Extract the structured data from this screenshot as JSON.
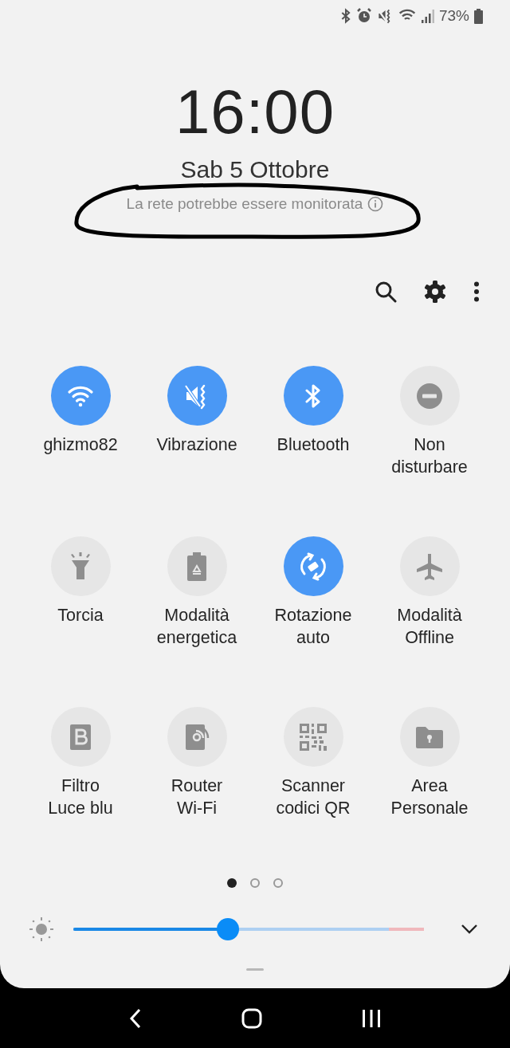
{
  "status_bar": {
    "battery": "73%"
  },
  "clock": {
    "time": "16:00",
    "date": "Sab 5 Ottobre",
    "network_notice": "La rete potrebbe essere monitorata"
  },
  "tiles": [
    {
      "label": "ghizmo82",
      "on": true
    },
    {
      "label": "Vibrazione",
      "on": true
    },
    {
      "label": "Bluetooth",
      "on": true
    },
    {
      "label": "Non\ndisturbare",
      "on": false
    },
    {
      "label": "Torcia",
      "on": false
    },
    {
      "label": "Modalità\nenergetica",
      "on": false
    },
    {
      "label": "Rotazione\nauto",
      "on": true
    },
    {
      "label": "Modalità\nOffline",
      "on": false
    },
    {
      "label": "Filtro\nLuce blu",
      "on": false
    },
    {
      "label": "Router\nWi-Fi",
      "on": false
    },
    {
      "label": "Scanner\ncodici QR",
      "on": false
    },
    {
      "label": "Area\nPersonale",
      "on": false
    }
  ],
  "page_indicator": [
    {
      "selected": true
    },
    {
      "selected": false
    },
    {
      "selected": false
    }
  ],
  "brightness": {
    "level": 0.44
  }
}
